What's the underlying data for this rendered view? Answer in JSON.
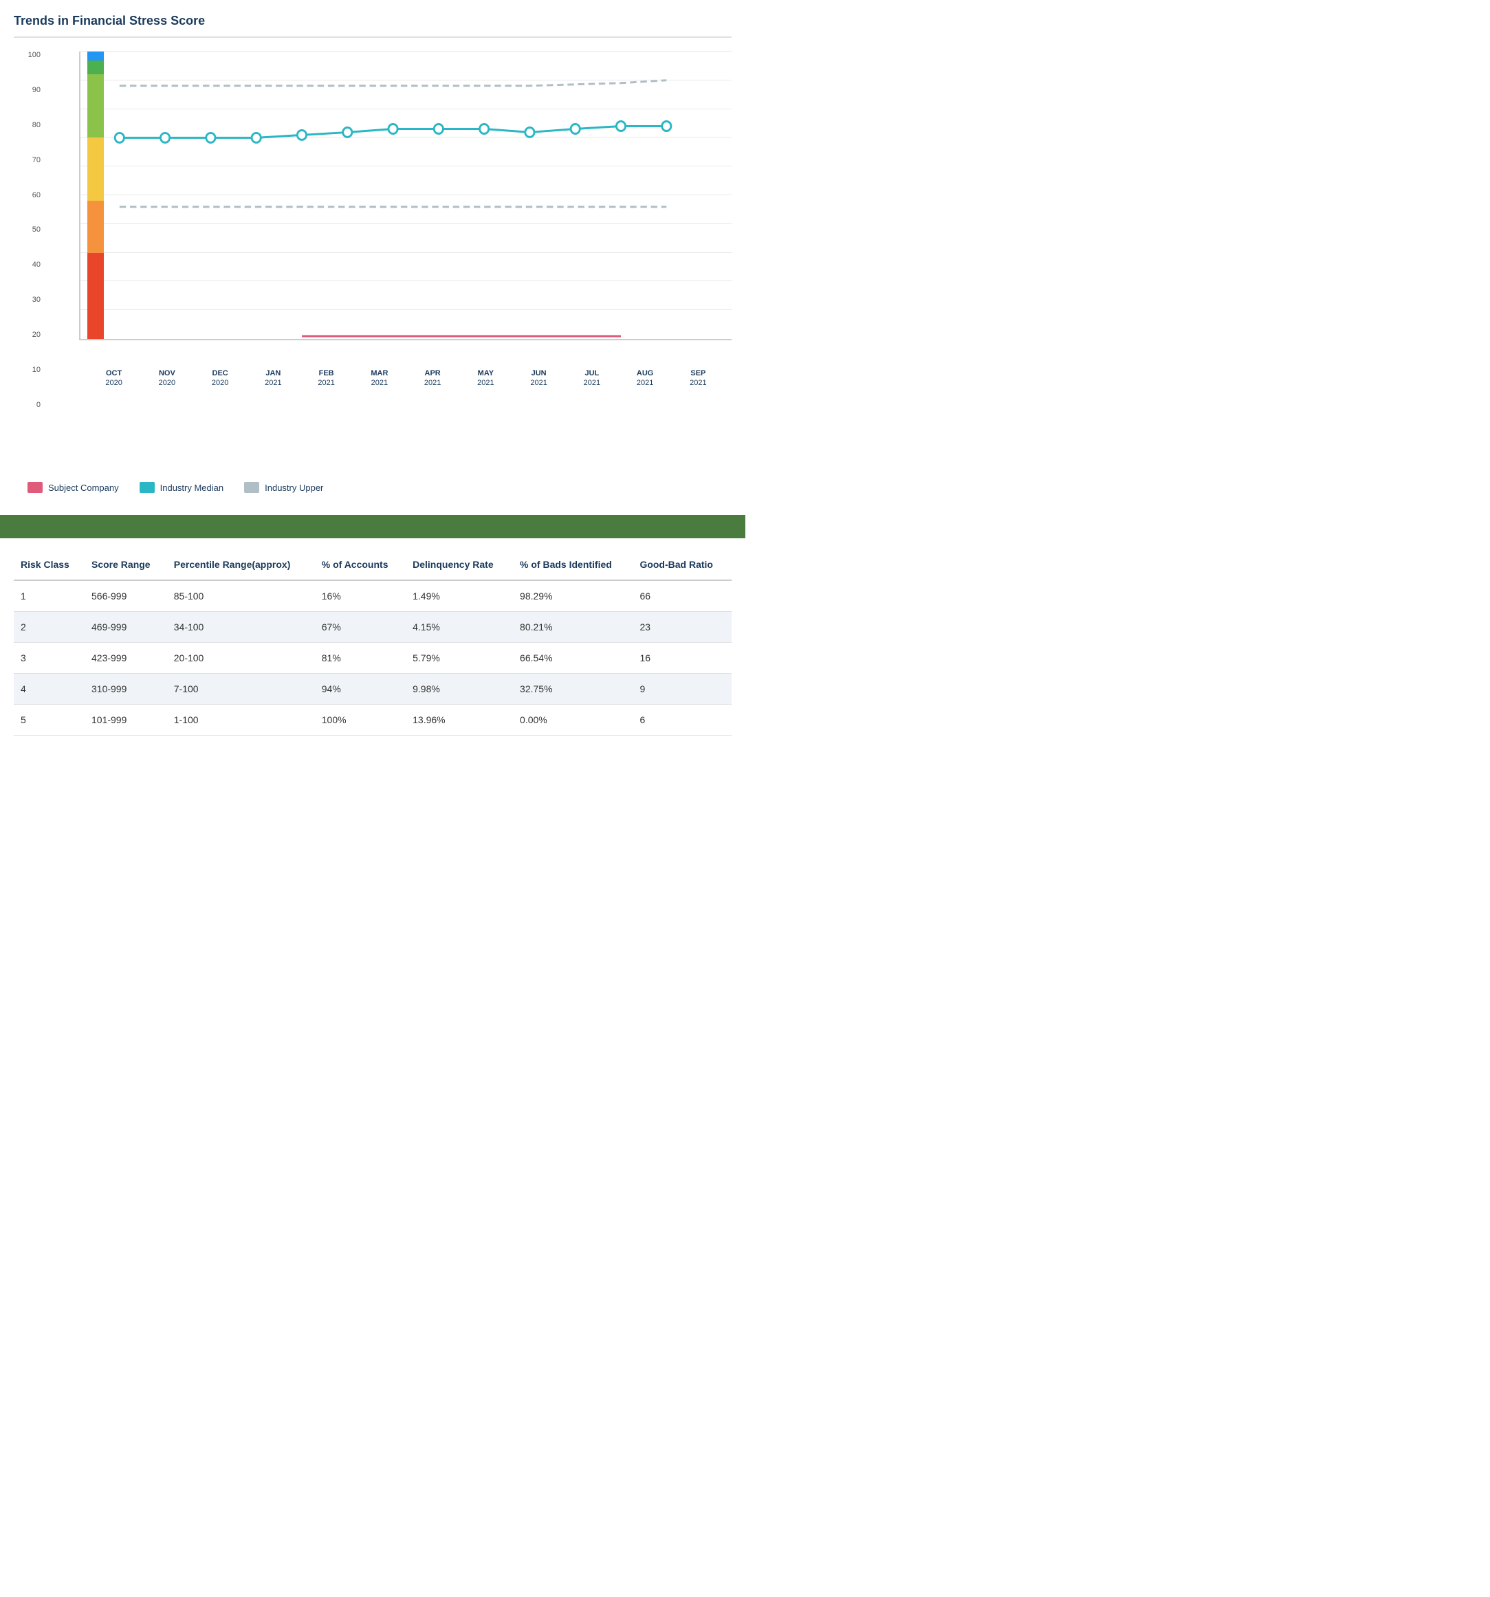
{
  "title": "Trends in Financial Stress Score",
  "chart": {
    "y_labels": [
      "0",
      "10",
      "20",
      "30",
      "40",
      "50",
      "60",
      "70",
      "80",
      "90",
      "100"
    ],
    "x_months": [
      {
        "month": "OCT",
        "year": "2020"
      },
      {
        "month": "NOV",
        "year": "2020"
      },
      {
        "month": "DEC",
        "year": "2020"
      },
      {
        "month": "JAN",
        "year": "2021"
      },
      {
        "month": "FEB",
        "year": "2021"
      },
      {
        "month": "MAR",
        "year": "2021"
      },
      {
        "month": "APR",
        "year": "2021"
      },
      {
        "month": "MAY",
        "year": "2021"
      },
      {
        "month": "JUN",
        "year": "2021"
      },
      {
        "month": "JUL",
        "year": "2021"
      },
      {
        "month": "AUG",
        "year": "2021"
      },
      {
        "month": "SEP",
        "year": "2021"
      }
    ],
    "subject_company_line": [
      70,
      70,
      70,
      70,
      70,
      71,
      72,
      73,
      73,
      72,
      73,
      74,
      74
    ],
    "industry_median_line": [
      46,
      46,
      46,
      46,
      46,
      46,
      46,
      46,
      46,
      46,
      46,
      46,
      46
    ],
    "industry_upper_line": [
      88,
      88,
      88,
      88,
      88,
      88,
      88,
      88,
      88,
      89,
      89,
      90,
      90
    ],
    "bar_segments": [
      {
        "color": "#e8452a",
        "height": 30,
        "label": "red"
      },
      {
        "color": "#f5923e",
        "height": 18,
        "label": "orange"
      },
      {
        "color": "#f5c842",
        "height": 22,
        "label": "yellow"
      },
      {
        "color": "#8bc34a",
        "height": 22,
        "label": "light-green"
      },
      {
        "color": "#4caf50",
        "height": 5,
        "label": "green"
      },
      {
        "color": "#2196f3",
        "height": 3,
        "label": "blue"
      }
    ],
    "subject_company_color": "#e05a7a",
    "industry_median_color": "#29b6c5",
    "industry_upper_color": "#b0bec5"
  },
  "legend": {
    "items": [
      {
        "label": "Subject Company",
        "color": "#e05a7a"
      },
      {
        "label": "Industry Median",
        "color": "#29b6c5"
      },
      {
        "label": "Industry Upper",
        "color": "#b0bec5"
      }
    ]
  },
  "table": {
    "headers": [
      "Risk Class",
      "Score Range",
      "Percentile Range(approx)",
      "% of Accounts",
      "Delinquency Rate",
      "% of Bads Identified",
      "Good-Bad Ratio"
    ],
    "rows": [
      {
        "risk_class": "1",
        "score_range": "566-999",
        "percentile": "85-100",
        "pct_accounts": "16%",
        "delinquency_rate": "1.49%",
        "pct_bads": "98.29%",
        "good_bad": "66"
      },
      {
        "risk_class": "2",
        "score_range": "469-999",
        "percentile": "34-100",
        "pct_accounts": "67%",
        "delinquency_rate": "4.15%",
        "pct_bads": "80.21%",
        "good_bad": "23"
      },
      {
        "risk_class": "3",
        "score_range": "423-999",
        "percentile": "20-100",
        "pct_accounts": "81%",
        "delinquency_rate": "5.79%",
        "pct_bads": "66.54%",
        "good_bad": "16"
      },
      {
        "risk_class": "4",
        "score_range": "310-999",
        "percentile": "7-100",
        "pct_accounts": "94%",
        "delinquency_rate": "9.98%",
        "pct_bads": "32.75%",
        "good_bad": "9"
      },
      {
        "risk_class": "5",
        "score_range": "101-999",
        "percentile": "1-100",
        "pct_accounts": "100%",
        "delinquency_rate": "13.96%",
        "pct_bads": "0.00%",
        "good_bad": "6"
      }
    ]
  }
}
